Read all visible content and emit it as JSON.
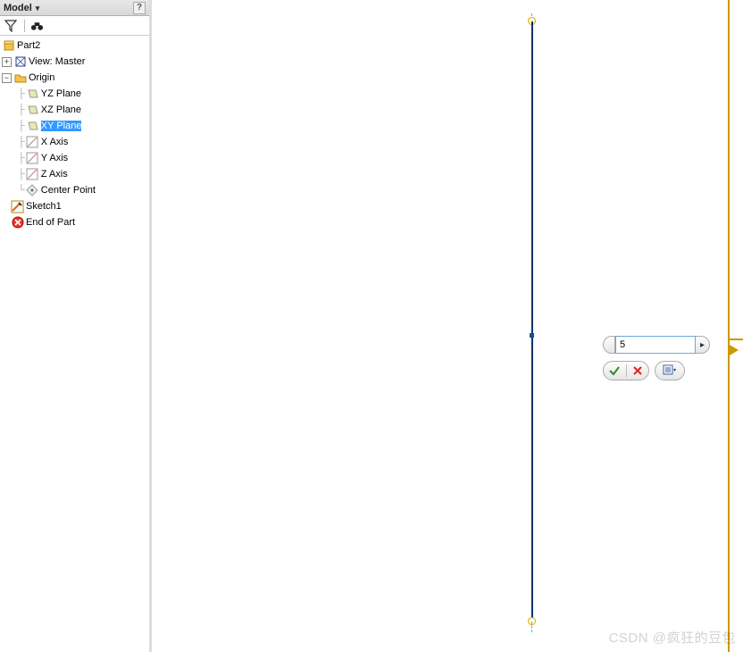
{
  "sidebar": {
    "title": "Model",
    "help_label": "?",
    "toolbar": {
      "filter": "filter-icon",
      "find": "binoculars-icon"
    },
    "tree": {
      "root_label": "Part2",
      "view_label": "View: Master",
      "origin_label": "Origin",
      "planes": {
        "yz": "YZ Plane",
        "xz": "XZ Plane",
        "xy": "XY Plane"
      },
      "axes": {
        "x": "X Axis",
        "y": "Y Axis",
        "z": "Z Axis"
      },
      "center_label": "Center Point",
      "sketch_label": "Sketch1",
      "end_label": "End of Part"
    }
  },
  "popup": {
    "value": "5"
  },
  "watermark": "CSDN @疯狂的豆包"
}
